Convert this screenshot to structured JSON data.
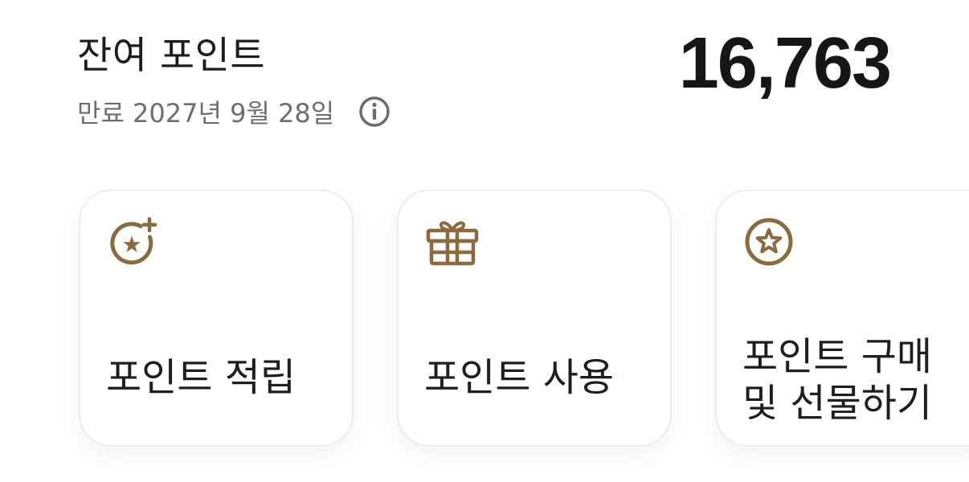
{
  "header": {
    "balance_label": "잔여 포인트",
    "balance_value": "16,763",
    "expiry_text": "만료 2027년 9월 28일",
    "info_icon": "info-icon"
  },
  "actions": [
    {
      "label": "포인트 적립",
      "icon": "star-plus-icon"
    },
    {
      "label": "포인트 사용",
      "icon": "gift-icon"
    },
    {
      "label": "포인트 구매\n및 선물하기",
      "icon": "star-badge-icon"
    }
  ],
  "colors": {
    "accent": "#8a6b3e",
    "text_primary": "#1a1a1a",
    "text_secondary": "#6e6e6e",
    "card_border": "#ececec"
  }
}
